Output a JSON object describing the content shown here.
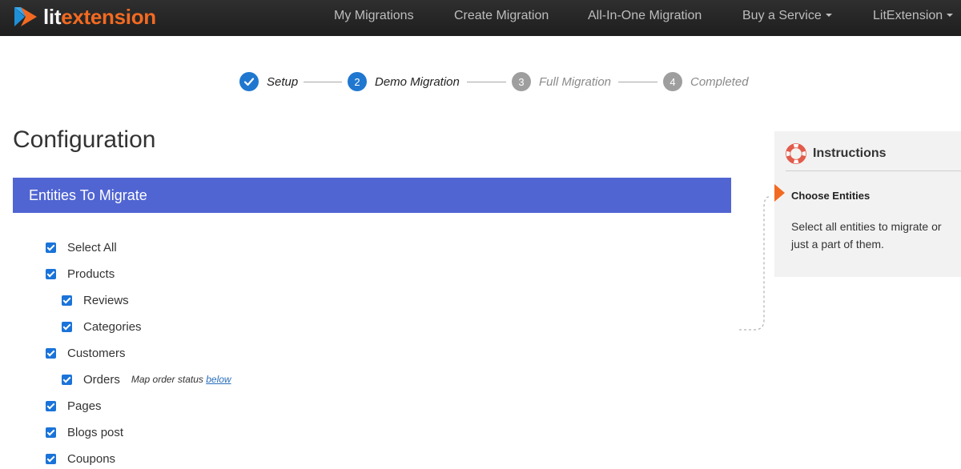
{
  "brand": {
    "name_part1": "lit",
    "name_part2": "extension",
    "accent_color": "#f26a21",
    "logo_icon": "litextension-logo-icon"
  },
  "nav": {
    "items": [
      {
        "label": "My Migrations",
        "has_dropdown": false
      },
      {
        "label": "Create Migration",
        "has_dropdown": false
      },
      {
        "label": "All-In-One Migration",
        "has_dropdown": false
      },
      {
        "label": "Buy a Service",
        "has_dropdown": true
      },
      {
        "label": "LitExtension",
        "has_dropdown": true
      }
    ]
  },
  "stepper": {
    "steps": [
      {
        "number": "",
        "label": "Setup",
        "state": "done",
        "icon": "check-icon"
      },
      {
        "number": "2",
        "label": "Demo Migration",
        "state": "current"
      },
      {
        "number": "3",
        "label": "Full Migration",
        "state": "todo"
      },
      {
        "number": "4",
        "label": "Completed",
        "state": "todo"
      }
    ],
    "active_color": "#1f77d0",
    "inactive_color": "#9e9e9e"
  },
  "page": {
    "title": "Configuration"
  },
  "entities_section": {
    "title": "Entities To Migrate",
    "header_color": "#5065d2",
    "items": [
      {
        "label": "Select All",
        "checked": true,
        "indent": 0
      },
      {
        "label": "Products",
        "checked": true,
        "indent": 0
      },
      {
        "label": "Reviews",
        "checked": true,
        "indent": 1
      },
      {
        "label": "Categories",
        "checked": true,
        "indent": 1
      },
      {
        "label": "Customers",
        "checked": true,
        "indent": 0
      },
      {
        "label": "Orders",
        "checked": true,
        "indent": 1
      },
      {
        "label": "Pages",
        "checked": true,
        "indent": 0
      },
      {
        "label": "Blogs post",
        "checked": true,
        "indent": 0
      },
      {
        "label": "Coupons",
        "checked": true,
        "indent": 0
      }
    ],
    "orders_note": {
      "text": "Map order status ",
      "link_text": "below"
    }
  },
  "instructions": {
    "title": "Instructions",
    "icon": "lifebuoy-icon",
    "step_title": "Choose Entities",
    "body": "Select all entities to migrate or just a part of them."
  }
}
